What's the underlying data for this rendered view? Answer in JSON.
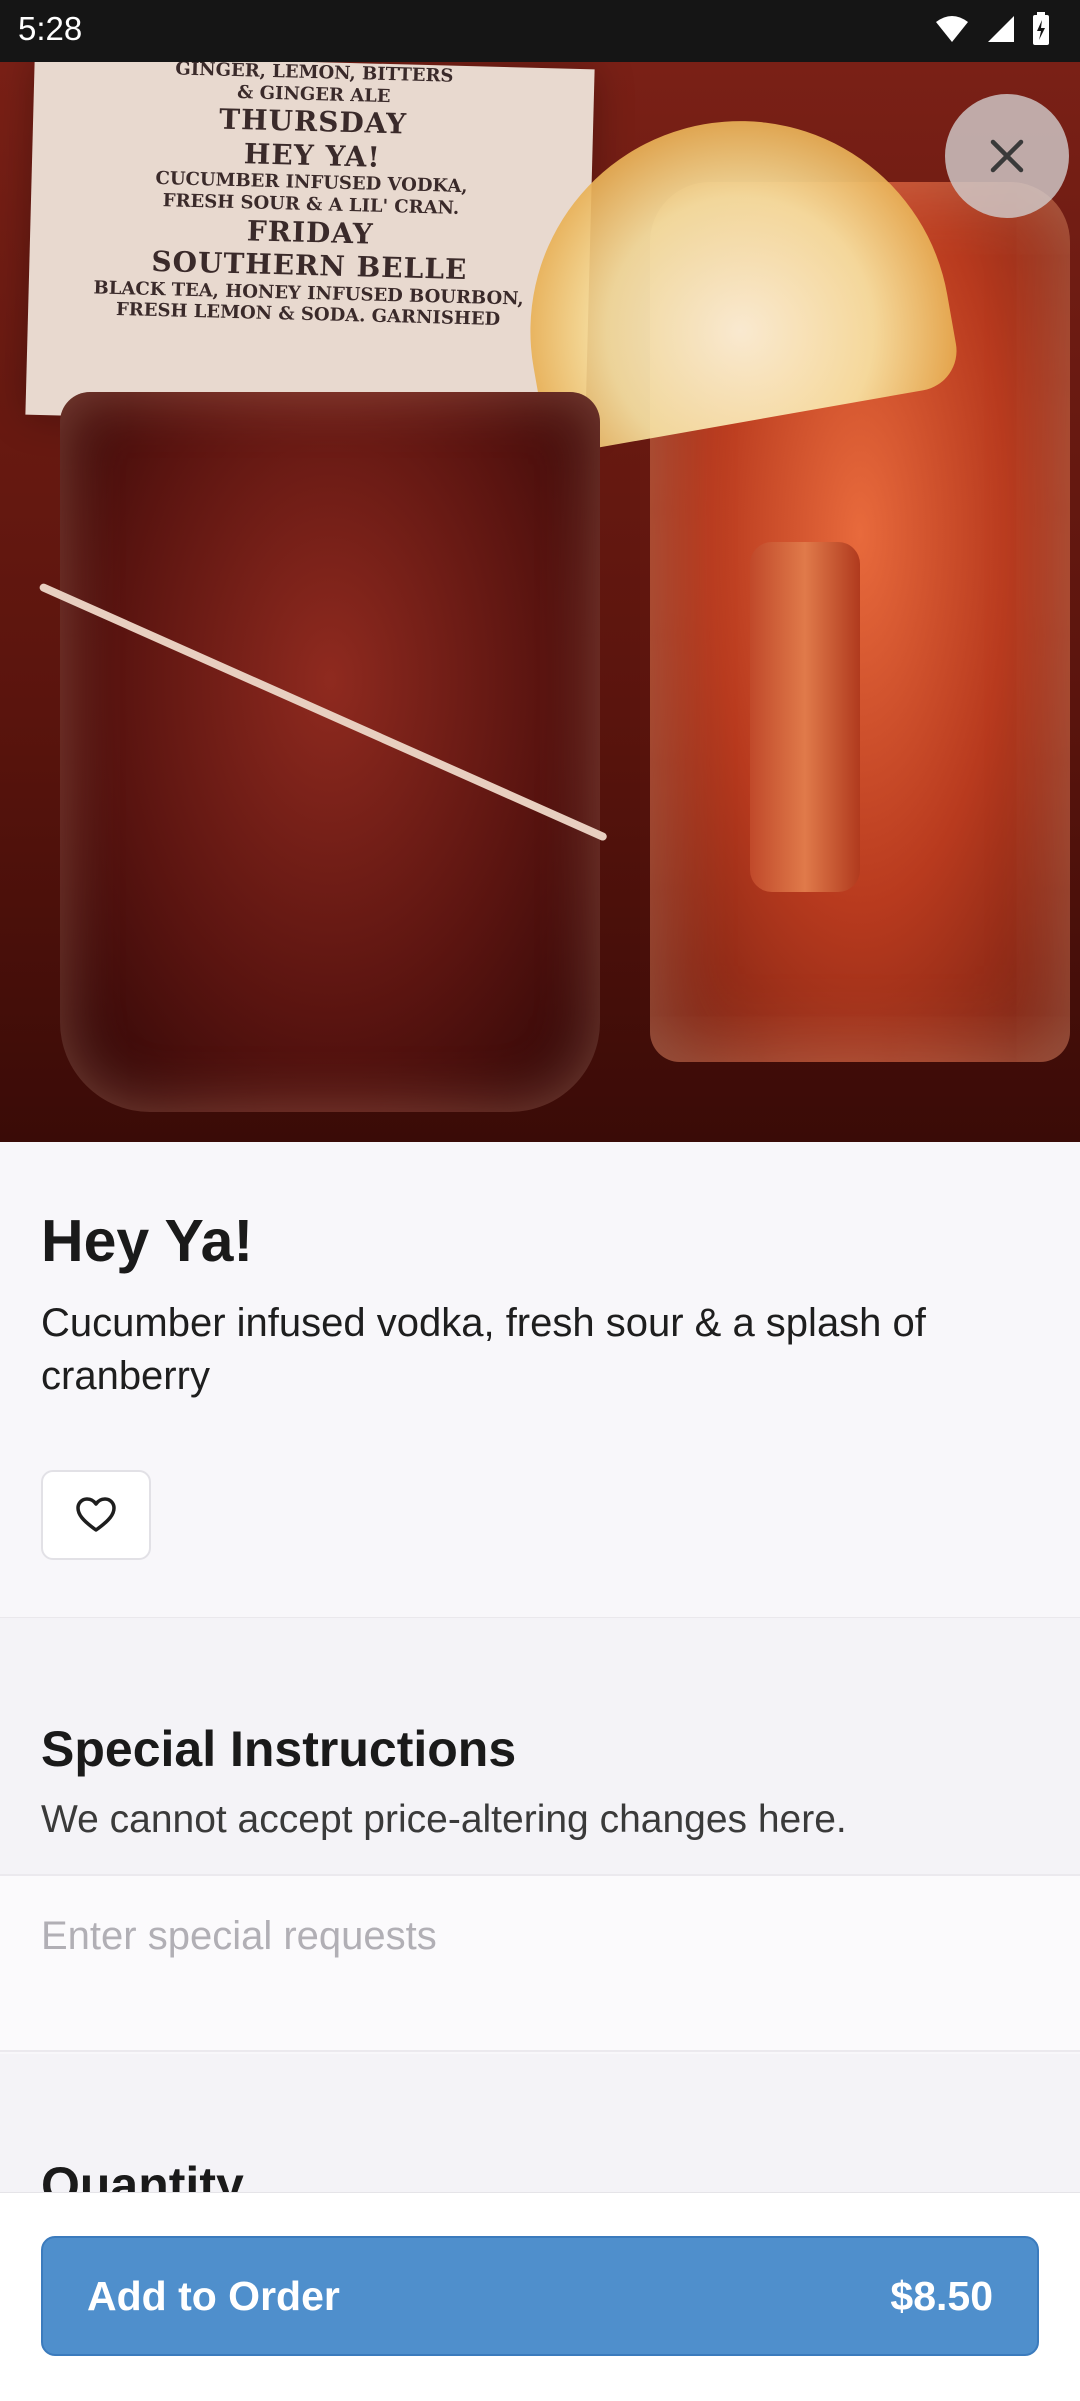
{
  "status_bar": {
    "time": "5:28"
  },
  "hero": {
    "menu_lines": [
      "GINGER, LEMON, BITTERS",
      "& GINGER ALE",
      "THURSDAY",
      "HEY YA!",
      "CUCUMBER INFUSED VODKA,",
      "FRESH SOUR & A LIL' CRAN.",
      "FRIDAY",
      "SOUTHERN BELLE",
      "BLACK TEA, HONEY INFUSED BOURBON,",
      "FRESH LEMON & SODA. GARNISHED"
    ]
  },
  "item": {
    "name": "Hey Ya!",
    "description": "Cucumber infused vodka, fresh sour & a splash of cranberry"
  },
  "special_instructions": {
    "title": "Special Instructions",
    "subtitle": "We cannot accept price-altering changes here.",
    "placeholder": "Enter special requests"
  },
  "quantity": {
    "title": "Quantity"
  },
  "order": {
    "button_label": "Add to Order",
    "price": "$8.50"
  },
  "colors": {
    "accent": "#4f8fcc"
  },
  "icons": {
    "close": "close-icon",
    "favorite": "heart-icon"
  }
}
